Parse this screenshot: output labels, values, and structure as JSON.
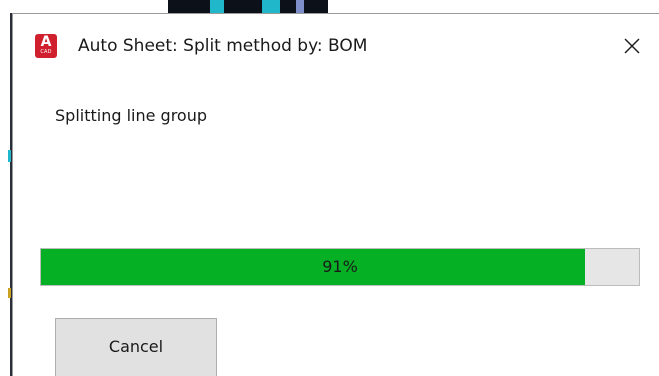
{
  "window": {
    "title": "Auto Sheet: Split method by: BOM",
    "icon": "autocad-app-icon",
    "icon_letter": "A",
    "icon_sublabel": "CAD",
    "close_glyph": "×"
  },
  "status": {
    "message": "Splitting line group"
  },
  "progress": {
    "percent": 91,
    "label": "91%"
  },
  "buttons": {
    "cancel_label": "Cancel"
  },
  "colors": {
    "progress_fill": "#06b025",
    "progress_track": "#e6e6e6",
    "icon_red": "#d0202e",
    "button_face": "#e1e1e1"
  }
}
